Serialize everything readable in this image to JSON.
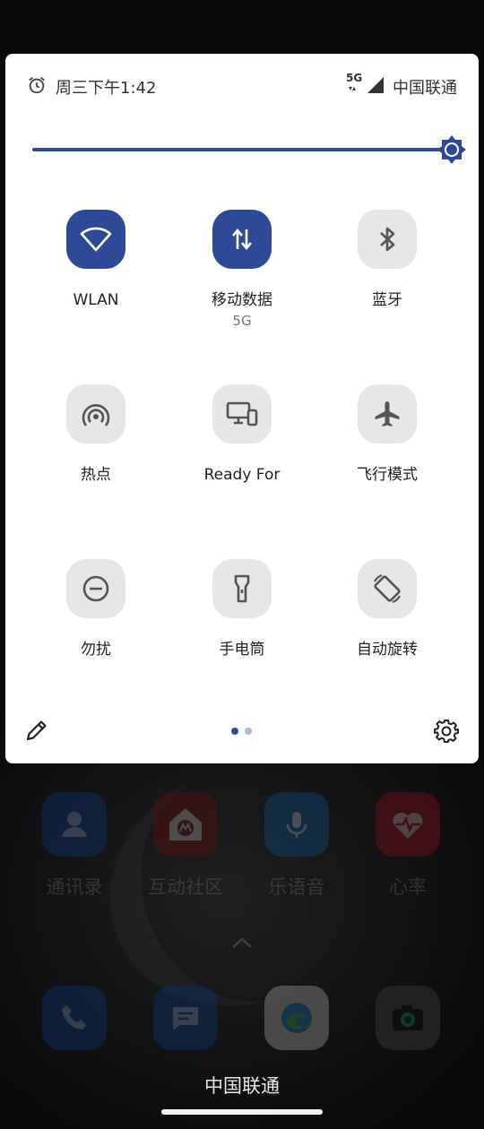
{
  "status_bar": {
    "time": "周三下午1:42",
    "network_type": "5G",
    "carrier": "中国联通"
  },
  "brightness": {
    "level": 1.0
  },
  "tiles": [
    {
      "label": "WLAN",
      "sub": "",
      "icon": "wifi-icon",
      "active": true
    },
    {
      "label": "移动数据",
      "sub": "5G",
      "icon": "mobile-data-icon",
      "active": true
    },
    {
      "label": "蓝牙",
      "sub": "",
      "icon": "bluetooth-icon",
      "active": false
    },
    {
      "label": "热点",
      "sub": "",
      "icon": "hotspot-icon",
      "active": false
    },
    {
      "label": "Ready For",
      "sub": "",
      "icon": "ready-for-icon",
      "active": false
    },
    {
      "label": "飞行模式",
      "sub": "",
      "icon": "airplane-icon",
      "active": false
    },
    {
      "label": "勿扰",
      "sub": "",
      "icon": "do-not-disturb-icon",
      "active": false
    },
    {
      "label": "手电筒",
      "sub": "",
      "icon": "flashlight-icon",
      "active": false
    },
    {
      "label": "自动旋转",
      "sub": "",
      "icon": "auto-rotate-icon",
      "active": false
    }
  ],
  "pagination": {
    "current": 1,
    "total": 2
  },
  "home_apps": [
    {
      "label": "通讯录",
      "icon": "contacts-icon"
    },
    {
      "label": "互动社区",
      "icon": "community-icon"
    },
    {
      "label": "乐语音",
      "icon": "voice-icon"
    },
    {
      "label": "心率",
      "icon": "heart-rate-icon"
    }
  ],
  "dock_apps": [
    {
      "icon": "phone-icon"
    },
    {
      "icon": "messages-icon"
    },
    {
      "icon": "edge-browser-icon"
    },
    {
      "icon": "camera-icon"
    }
  ],
  "bottom_carrier": "中国联通",
  "colors": {
    "accent": "#2e4a96",
    "tile_inactive": "#e6e6e6",
    "panel_bg": "#ffffff"
  }
}
